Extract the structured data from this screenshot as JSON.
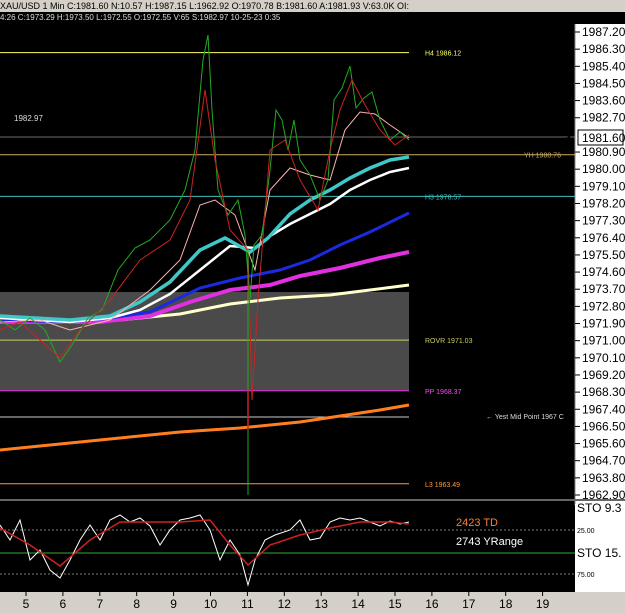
{
  "header": {
    "ohlc_line": "XAU/USD  1 Min  C:1981.60  N:10.57  H:1987.15  L:1962.92  O:1970.78  B:1981.60  A:1981.93  V:63.0K  OI:",
    "bar_info": "4:26  C:1973.29  H:1973.50  L:1972.55  O:1972.55  V:65  S:1982.97  10-25-23  0:35"
  },
  "price_annotation": "1982.97",
  "last_price": "1981.60",
  "levels": [
    {
      "label": "H4 1986.12",
      "value": 1986.12,
      "color": "#ffff66"
    },
    {
      "label": "YH 1980.76",
      "value": 1980.76,
      "color": "#ccaa66"
    },
    {
      "label": "H3 1978.57",
      "value": 1978.57,
      "color": "#40c0c0"
    },
    {
      "label": "ROVR 1971.03",
      "value": 1971.03,
      "color": "#cccc66"
    },
    {
      "label": "PP 1968.37",
      "value": 1968.37,
      "color": "#ff44ff"
    },
    {
      "label": "L3 1963.49",
      "value": 1963.49,
      "color": "#ff9a3a"
    }
  ],
  "yest_mid_label": "← Yest Mid Point 1967 C",
  "y_ticks": [
    "1987.20",
    "1986.30",
    "1985.40",
    "1984.50",
    "1983.60",
    "1982.70",
    "1980.90",
    "1980.00",
    "1979.10",
    "1978.20",
    "1977.30",
    "1976.40",
    "1975.50",
    "1974.60",
    "1973.70",
    "1972.80",
    "1971.90",
    "1971.00",
    "1970.10",
    "1969.20",
    "1968.30",
    "1967.40",
    "1966.50",
    "1965.60",
    "1964.70",
    "1963.80",
    "1962.90"
  ],
  "x_ticks": [
    "5",
    "6",
    "7",
    "8",
    "9",
    "10",
    "11",
    "12",
    "13",
    "14",
    "15",
    "16",
    "17",
    "18",
    "19"
  ],
  "stochastic": {
    "td_label": "2423 TD",
    "yrange_label": "2743 YRange",
    "sto_top": "STO 9.3",
    "sto_mid": "STO 15.",
    "level_25": "25.00",
    "level_75": "75.00"
  },
  "colors": {
    "price_up": "#22aa22",
    "price_down": "#cc2222",
    "ma_cyan": "#40c8c8",
    "ma_white": "#ffffff",
    "ma_blue": "#1a2ae0",
    "ma_magenta": "#e030e0",
    "ma_cream": "#ffffcc",
    "ma_orange": "#ff7f20",
    "ma_pink": "#ffb0b0",
    "axis_bg": "#ffffff",
    "td_color": "#ff7f30"
  }
}
